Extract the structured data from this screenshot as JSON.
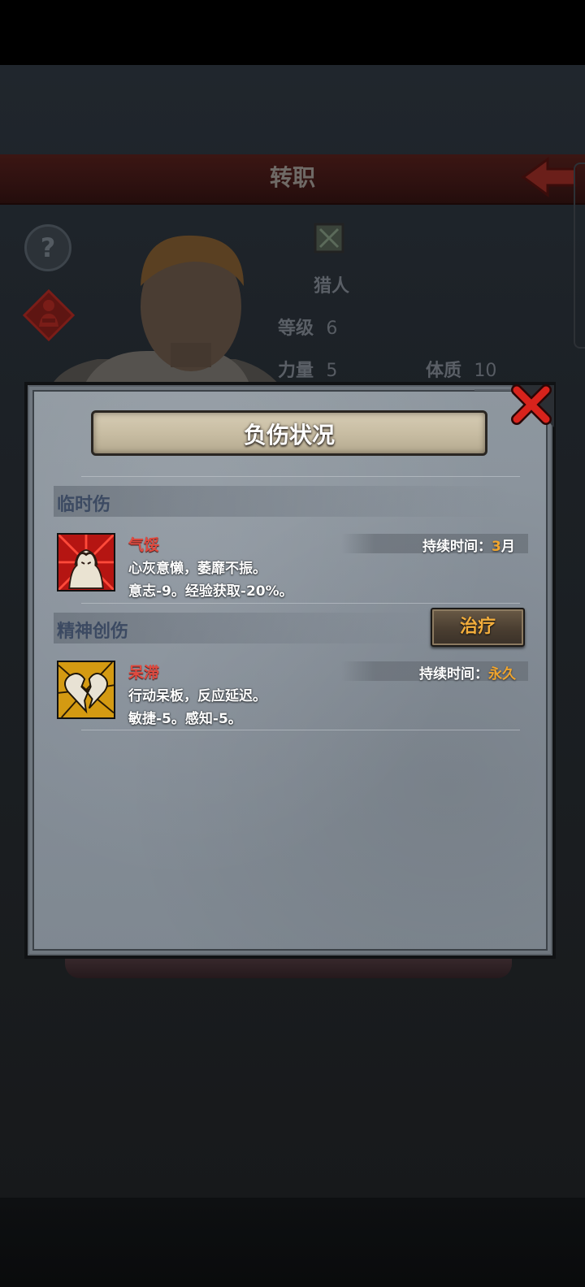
{
  "background_screen": {
    "header_title": "转职",
    "help_glyph": "?",
    "class_name": "猎人",
    "stats": {
      "level_label": "等级",
      "level_value": "6",
      "strength_label": "力量",
      "strength_value": "5",
      "constitution_label": "体质",
      "constitution_value": "10"
    },
    "icons": [
      "back-arrow-icon",
      "help-icon",
      "injury-status-icon",
      "class-hunter-icon",
      "character-portrait"
    ]
  },
  "modal": {
    "title": "负伤状况",
    "close_icon": "close-x-icon",
    "sections": [
      {
        "title": "临时伤",
        "entries": [
          {
            "name": "气馁",
            "icon": "despair-icon",
            "desc_line1": "心灰意懒，萎靡不振。",
            "desc_line2": "意志-9。经验获取-20%。",
            "duration_label": "持续时间：",
            "duration_value": "3",
            "duration_unit": "月"
          }
        ]
      },
      {
        "title": "精神创伤",
        "action_label": "治疗",
        "entries": [
          {
            "name": "呆滞",
            "icon": "broken-heart-icon",
            "desc_line1": "行动呆板，反应延迟。",
            "desc_line2": "敏捷-5。感知-5。",
            "duration_label": "持续时间：",
            "duration_value": "永久"
          }
        ]
      }
    ]
  },
  "colors": {
    "status_name": "#e04a3f",
    "duration_value": "#f0a52e",
    "section_title": "#3c4a62",
    "panel": "#8a939c"
  }
}
